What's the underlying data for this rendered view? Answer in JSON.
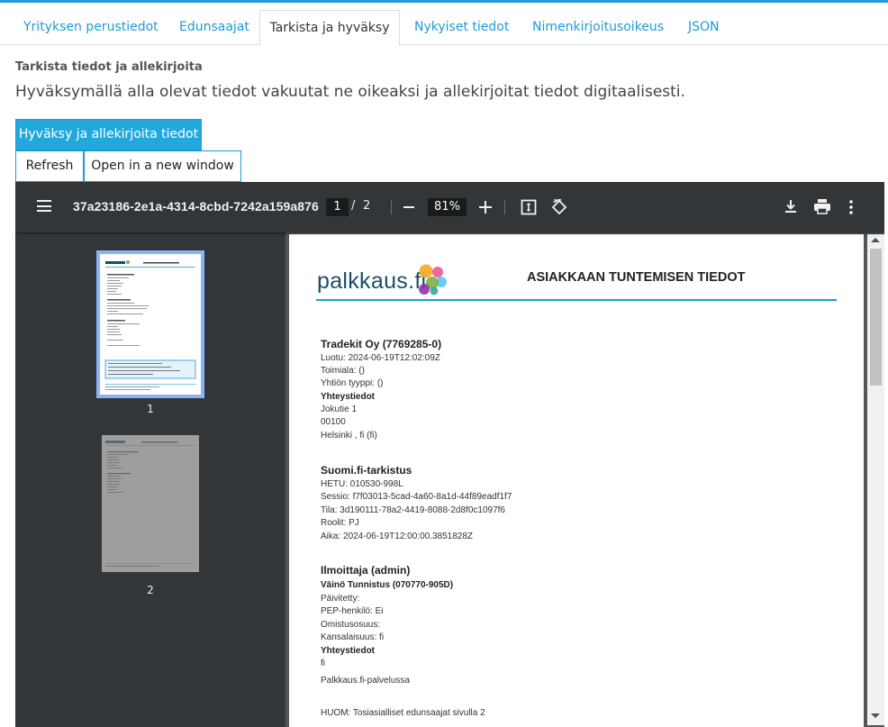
{
  "tabs": [
    {
      "label": "Yrityksen perustiedot"
    },
    {
      "label": "Edunsaajat"
    },
    {
      "label": "Tarkista ja hyväksy"
    },
    {
      "label": "Nykyiset tiedot"
    },
    {
      "label": "Nimenkirjoitusoikeus"
    },
    {
      "label": "JSON"
    }
  ],
  "active_tab": "Tarkista ja hyväksy",
  "section": {
    "subtitle": "Tarkista tiedot ja allekirjoita",
    "description": "Hyväksymällä alla olevat tiedot vakuutat ne oikeaksi ja allekirjoitat tiedot digitaalisesti."
  },
  "buttons": {
    "approve": "Hyväksy ja allekirjoita tiedot",
    "refresh": "Refresh",
    "open_window": "Open in a new window"
  },
  "pdf_viewer": {
    "doc_title": "37a23186-2e1a-4314-8cbd-7242a159a876",
    "current_page": "1",
    "page_separator": "/",
    "total_pages": "2",
    "zoom": "81%",
    "thumbnails": [
      "1",
      "2"
    ]
  },
  "document": {
    "logo_text": "palkkaus.fi",
    "heading": "ASIAKKAAN TUNTEMISEN TIEDOT",
    "company": {
      "title": "Tradekit Oy (7769285-0)",
      "created": "Luotu: 2024-06-19T12:02:09Z",
      "industry": "Toimiala: ()",
      "company_type": "Yhtiön tyyppi: ()",
      "contact_heading": "Yhteystiedot",
      "street": "Jokutie 1",
      "postal": "00100",
      "city": "Helsinki , fi (fi)"
    },
    "suomifi": {
      "title": "Suomi.fi-tarkistus",
      "hetu": "HETU: 010530-998L",
      "session": "Sessio: f7f03013-5cad-4a60-8a1d-44f89eadf1f7",
      "state": "Tila: 3d190111-78a2-4419-8088-2d8f0c1097f6",
      "roles": "Roolit: PJ",
      "time": "Aika: 2024-06-19T12:00:00.3851828Z"
    },
    "reporter": {
      "title": "Ilmoittaja (admin)",
      "name": "Väinö Tunnistus (070770-905D)",
      "updated": "Päivitetty:",
      "pep": "PEP-henkilö: Ei",
      "ownership": "Omistusosuus:",
      "nationality": "Kansalaisuus: fi",
      "contact_heading": "Yhteystiedot",
      "contact_value": "fi",
      "service": "Palkkaus.fi-palvelussa"
    },
    "note": "HUOM: Tosiasialliset edunsaajat sivulla 2"
  },
  "colors": {
    "accent": "#1e9bd7",
    "toolbar": "#323639",
    "viewer_bg": "#525659"
  }
}
